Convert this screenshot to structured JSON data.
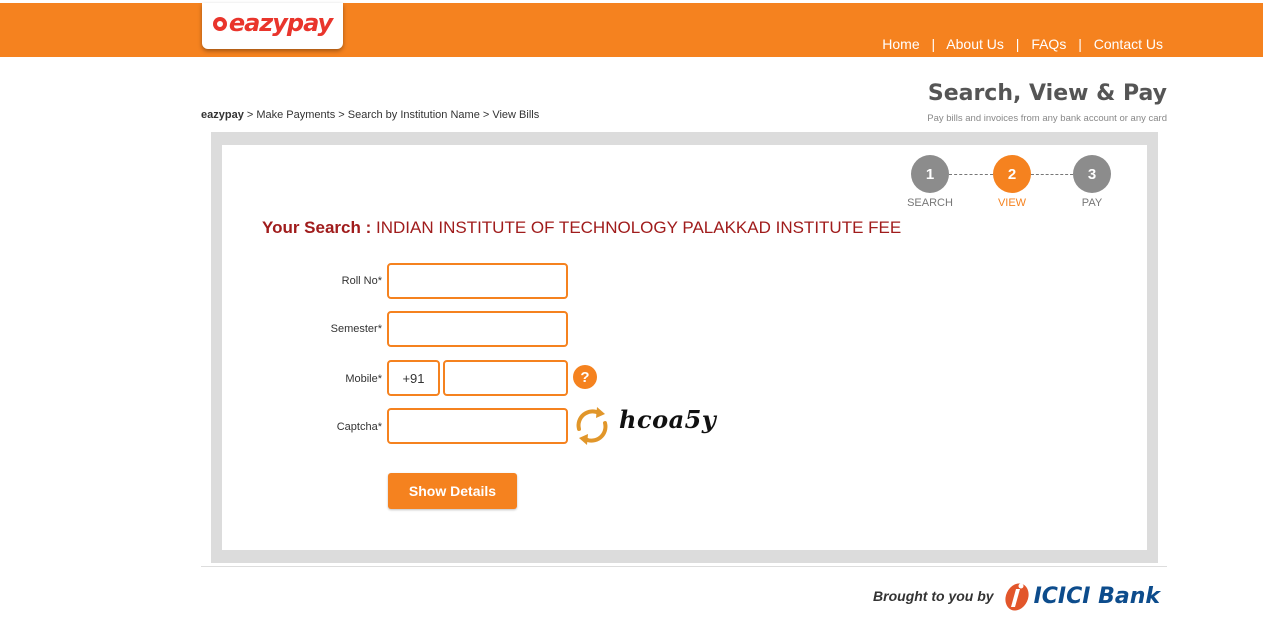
{
  "header": {
    "logo_text": "eazypay",
    "nav": [
      "Home",
      "About Us",
      "FAQs",
      "Contact Us"
    ],
    "nav_separator": "|"
  },
  "breadcrumb": {
    "root": "eazypay",
    "trail": " > Make Payments > Search by Institution Name > View Bills"
  },
  "page": {
    "title": "Search, View & Pay",
    "subtitle": "Pay bills and invoices from any bank account or any card"
  },
  "steps": [
    {
      "number": "1",
      "label": "SEARCH",
      "active": false
    },
    {
      "number": "2",
      "label": "VIEW",
      "active": true
    },
    {
      "number": "3",
      "label": "PAY",
      "active": false
    }
  ],
  "search": {
    "key": "Your Search :",
    "value": "INDIAN INSTITUTE OF TECHNOLOGY PALAKKAD INSTITUTE FEE"
  },
  "form": {
    "roll_no_label": "Roll No*",
    "roll_no_value": "",
    "semester_label": "Semester*",
    "semester_value": "",
    "mobile_label": "Mobile*",
    "mobile_prefix": "+91",
    "mobile_value": "",
    "mobile_help": "?",
    "captcha_label": "Captcha*",
    "captcha_value": "",
    "captcha_text": "hcoa5y",
    "submit_label": "Show Details"
  },
  "footer": {
    "byline": "Brought to you by",
    "bank_name": "ICICI Bank"
  },
  "colors": {
    "brand_orange": "#f5821f",
    "search_red": "#a01c1c",
    "step_gray": "#8c8c8c",
    "bank_blue": "#0d4c8c"
  },
  "icons": {
    "help": "question-mark-icon",
    "captcha_refresh": "refresh-icon",
    "bank_logo": "icici-logo-icon"
  }
}
